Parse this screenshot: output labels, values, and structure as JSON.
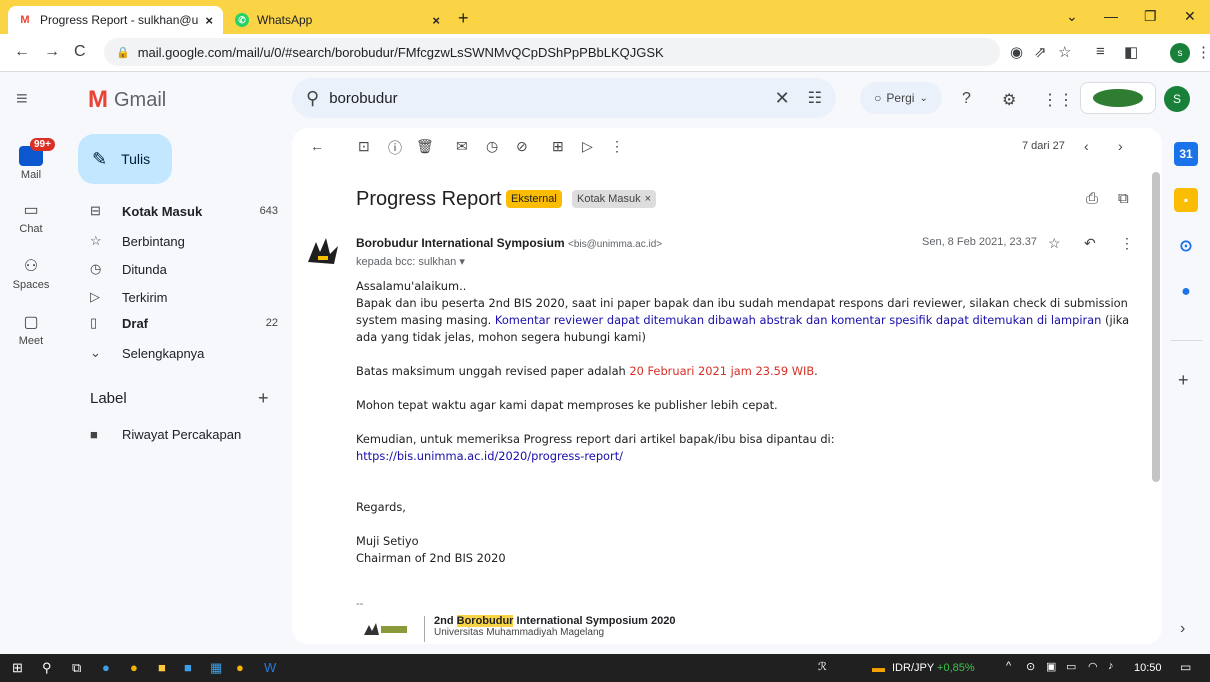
{
  "browser": {
    "tabs": [
      {
        "title": "Progress Report - sulkhan@uinsa",
        "favicon": "gmail-icon",
        "active": true
      },
      {
        "title": "WhatsApp",
        "favicon": "whatsapp-icon",
        "active": false
      }
    ],
    "url": "mail.google.com/mail/u/0/#search/borobudur/FMfcgzwLsSWNMvQCpDShPpPBbLKQJGSK",
    "profile_initial": "s",
    "accent": "#fbd446"
  },
  "gmail": {
    "logo_text": "Gmail",
    "search_value": "borobudur",
    "status": "Pergi",
    "avatar_initial": "S",
    "rail": [
      {
        "label": "Mail",
        "icon": "mail-icon",
        "badge": "99+"
      },
      {
        "label": "Chat",
        "icon": "chat-icon"
      },
      {
        "label": "Spaces",
        "icon": "spaces-icon"
      },
      {
        "label": "Meet",
        "icon": "meet-icon"
      }
    ],
    "compose_label": "Tulis",
    "nav": [
      {
        "label": "Kotak Masuk",
        "icon": "inbox-icon",
        "count": "643",
        "bold": true
      },
      {
        "label": "Berbintang",
        "icon": "star-icon",
        "count": ""
      },
      {
        "label": "Ditunda",
        "icon": "clock-icon",
        "count": ""
      },
      {
        "label": "Terkirim",
        "icon": "send-icon",
        "count": ""
      },
      {
        "label": "Draf",
        "icon": "draft-icon",
        "count": "22",
        "bold": true
      },
      {
        "label": "Selengkapnya",
        "icon": "chevron-down-icon",
        "count": ""
      }
    ],
    "labels_title": "Label",
    "labels": [
      {
        "label": "Riwayat Percakapan",
        "icon": "label-icon"
      }
    ]
  },
  "message": {
    "pager": "7 dari 27",
    "subject": "Progress Report",
    "chips": [
      "Eksternal",
      "Kotak Masuk"
    ],
    "sender_name": "Borobudur International Symposium",
    "sender_email": "<bis@unimma.ac.id>",
    "recipient": "kepada bcc: sulkhan",
    "date": "Sen, 8 Feb 2021, 23.37",
    "body": {
      "greeting": "Assalamu'alaikum..",
      "p1_start": "Bapak dan ibu peserta 2nd BIS 2020, saat ini paper bapak dan ibu sudah mendapat respons dari reviewer, silakan check di submission system masing masing.",
      "p1_blue": "Komentar reviewer dapat ditemukan dibawah abstrak dan komentar spesifik dapat ditemukan di lampiran",
      "p1_end": "(jika ada yang tidak jelas, mohon segera hubungi kami)",
      "deadline_start": "Batas maksimum unggah revised paper adalah",
      "deadline_red": "20 Februari 2021 jam 23.59 WIB",
      "deadline_end": ".",
      "p3": "Mohon tepat waktu agar kami dapat memproses ke publisher lebih cepat.",
      "p4": "Kemudian, untuk memeriksa Progress report dari artikel bapak/ibu bisa dipantau di:",
      "link": "https://bis.unimma.ac.id/2020/progress-report/",
      "regards": "Regards,",
      "sign_name": "Muji Setiyo",
      "sign_title": "Chairman of 2nd BIS 2020"
    },
    "sig_sep": "--",
    "sig_line1_a": "2nd ",
    "sig_line1_hl": "Borobudur",
    "sig_line1_b": " International Symposium 2020",
    "sig_line2": "Universitas Muhammadiyah Magelang"
  },
  "taskbar": {
    "ticker_label": "IDR/JPY",
    "ticker_change": "+0,85%",
    "time": "10:50"
  }
}
